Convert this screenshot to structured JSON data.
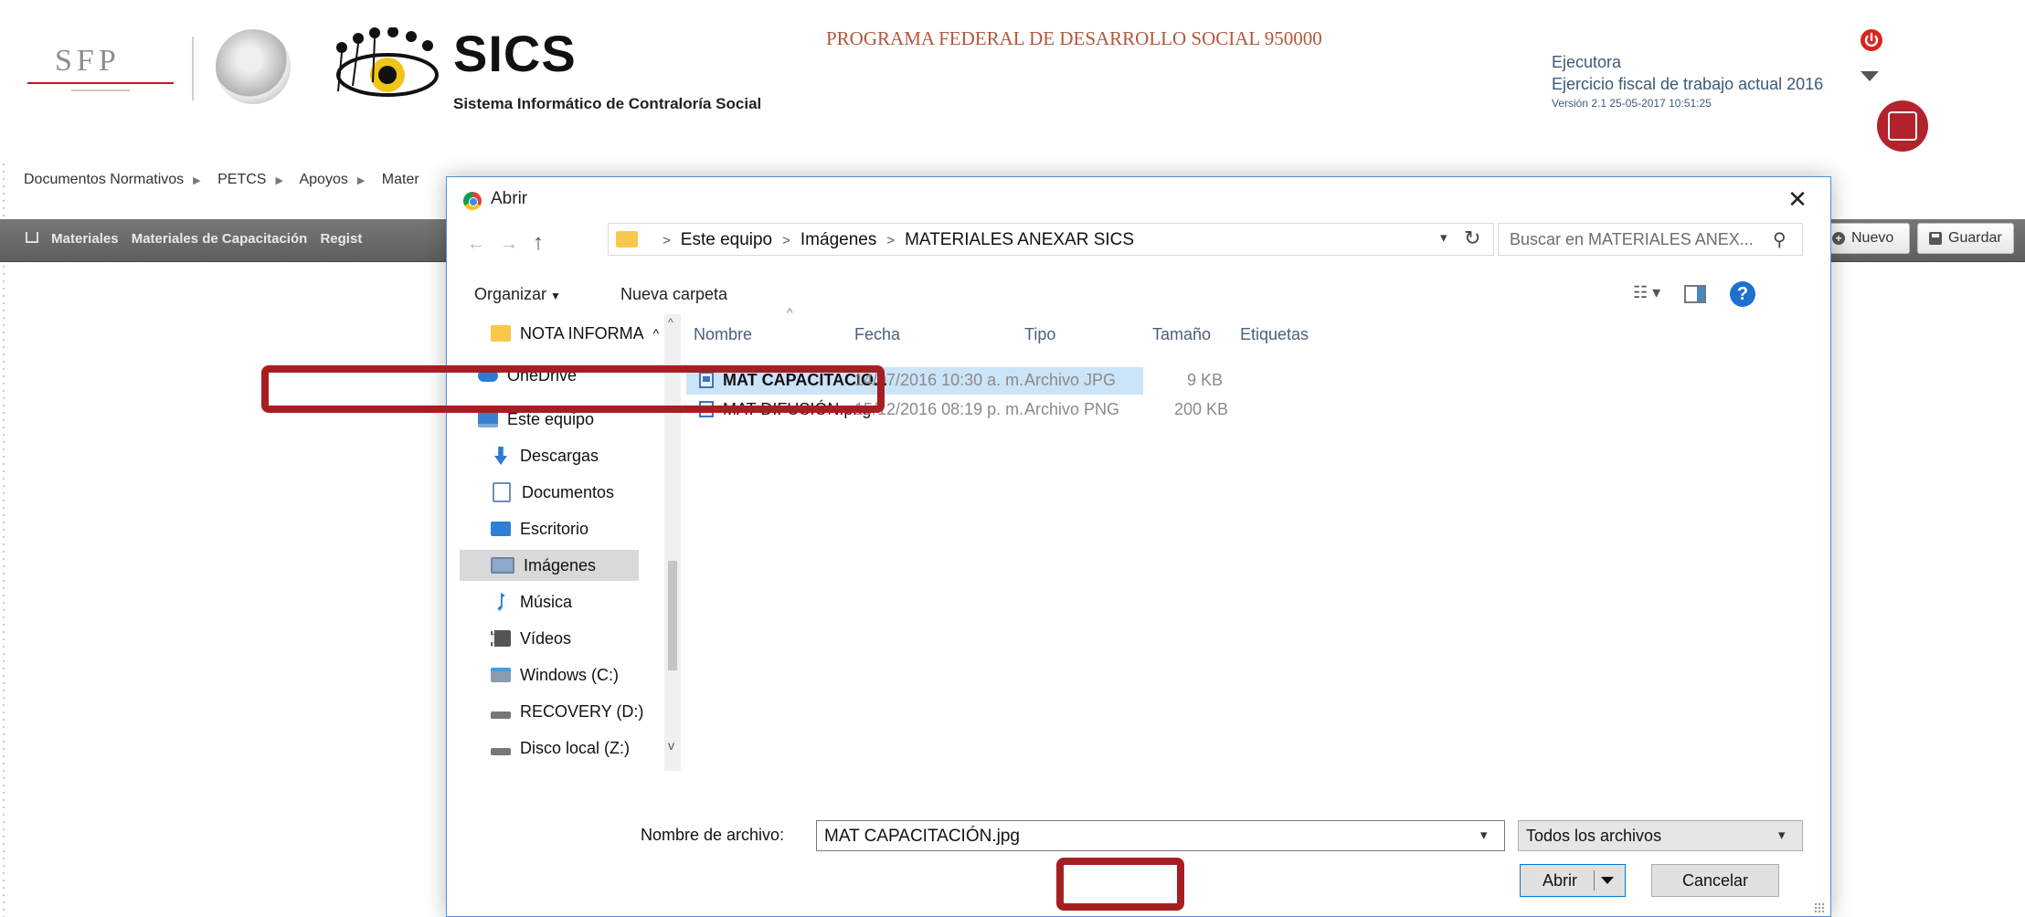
{
  "header": {
    "sfp_logo_text": "SFP",
    "app_name": "SICS",
    "app_subtitle": "Sistema Informático de Contraloría Social",
    "program_title": "PROGRAMA FEDERAL DE DESARROLLO SOCIAL 950000",
    "role": "Ejecutora",
    "fiscal_year": "Ejercicio fiscal de trabajo actual  2016",
    "version": "Versión 2.1    25-05-2017 10:51:25"
  },
  "main_nav": [
    "Documentos Normativos",
    "PETCS",
    "Apoyos",
    "Mater"
  ],
  "breadcrumb": [
    "Materiales",
    "Materiales de Capacitación",
    "Regist"
  ],
  "toolbar": {
    "nuevo": "Nuevo",
    "guardar": "Guardar"
  },
  "dialog": {
    "title": "Abrir",
    "close_glyph": "✕",
    "path": [
      "Este equipo",
      "Imágenes",
      "MATERIALES ANEXAR SICS"
    ],
    "search_placeholder": "Buscar en MATERIALES ANEX...",
    "organize": "Organizar",
    "new_folder": "Nueva carpeta",
    "nav_items": [
      {
        "label": "NOTA INFORMA",
        "icon": "folder-icon"
      },
      {
        "label": "OneDrive",
        "icon": "cloud-icon"
      },
      {
        "label": "Este equipo",
        "icon": "computer-icon"
      },
      {
        "label": "Descargas",
        "icon": "download-icon"
      },
      {
        "label": "Documentos",
        "icon": "document-icon"
      },
      {
        "label": "Escritorio",
        "icon": "desktop-icon"
      },
      {
        "label": "Imágenes",
        "icon": "pictures-icon"
      },
      {
        "label": "Música",
        "icon": "music-icon"
      },
      {
        "label": "Vídeos",
        "icon": "video-icon"
      },
      {
        "label": "Windows (C:)",
        "icon": "drive-c-icon"
      },
      {
        "label": "RECOVERY (D:)",
        "icon": "drive-icon"
      },
      {
        "label": "Disco local (Z:)",
        "icon": "drive-icon"
      }
    ],
    "columns": [
      "Nombre",
      "Fecha",
      "Tipo",
      "Tamaño",
      "Etiquetas"
    ],
    "files": [
      {
        "name": "MAT CAPACITACIÓ...",
        "date": "14/07/2016 10:30 a. m.",
        "type": "Archivo JPG",
        "size": "9 KB"
      },
      {
        "name": "MAT DIFUSIÓN.png",
        "date": "15/12/2016 08:19 p. m.",
        "type": "Archivo PNG",
        "size": "200 KB"
      }
    ],
    "filename_label": "Nombre de archivo:",
    "filename_value": "MAT CAPACITACIÓN.jpg",
    "filetype_value": "Todos los archivos",
    "open_label": "Abrir",
    "cancel_label": "Cancelar"
  },
  "colors": {
    "highlight": "#a61e22",
    "selection": "#cce4f7",
    "accent": "#0078d7"
  }
}
